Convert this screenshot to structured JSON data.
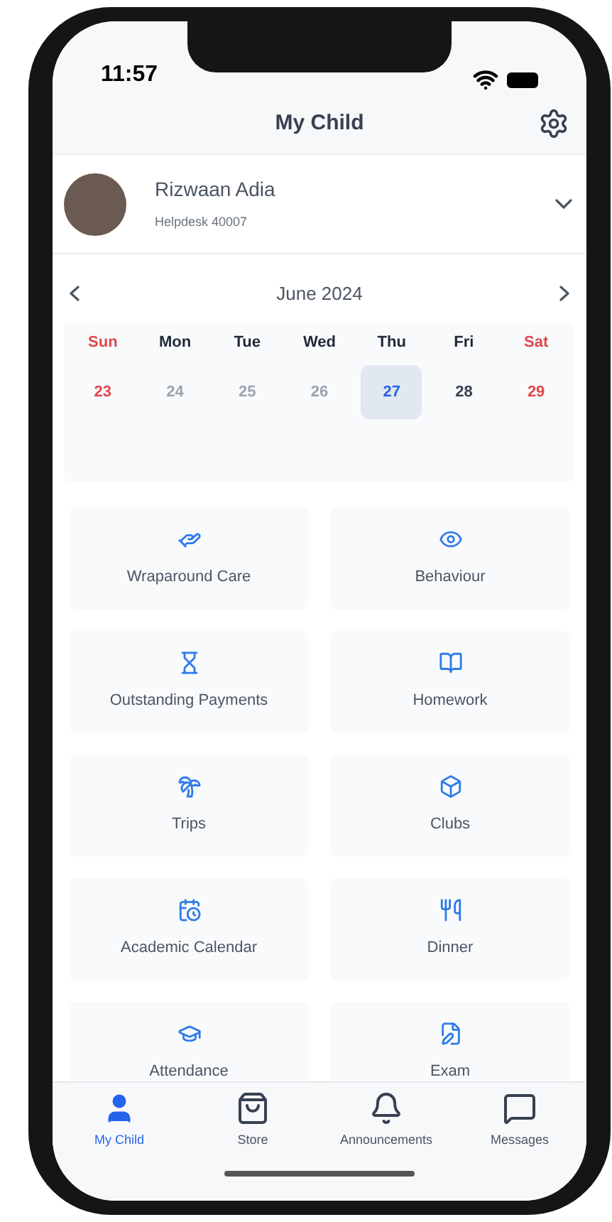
{
  "status_bar": {
    "time": "11:57"
  },
  "header": {
    "title": "My Child"
  },
  "profile": {
    "name": "Rizwaan Adia",
    "subtitle": "Helpdesk 40007"
  },
  "calendar": {
    "month": "June 2024",
    "weekdays": [
      {
        "label": "Sun",
        "weekend": true
      },
      {
        "label": "Mon",
        "weekend": false
      },
      {
        "label": "Tue",
        "weekend": false
      },
      {
        "label": "Wed",
        "weekend": false
      },
      {
        "label": "Thu",
        "weekend": false
      },
      {
        "label": "Fri",
        "weekend": false
      },
      {
        "label": "Sat",
        "weekend": true
      }
    ],
    "dates": [
      {
        "label": "23",
        "kind": "weekend",
        "selected": false
      },
      {
        "label": "24",
        "kind": "past",
        "selected": false
      },
      {
        "label": "25",
        "kind": "past",
        "selected": false
      },
      {
        "label": "26",
        "kind": "past",
        "selected": false
      },
      {
        "label": "27",
        "kind": "normal",
        "selected": true
      },
      {
        "label": "28",
        "kind": "normal",
        "selected": false
      },
      {
        "label": "29",
        "kind": "weekend",
        "selected": false
      }
    ]
  },
  "tiles": [
    {
      "label": "Wraparound Care"
    },
    {
      "label": "Behaviour"
    },
    {
      "label": "Outstanding Payments"
    },
    {
      "label": "Homework"
    },
    {
      "label": "Trips"
    },
    {
      "label": "Clubs"
    },
    {
      "label": "Academic Calendar"
    },
    {
      "label": "Dinner"
    },
    {
      "label": "Attendance"
    },
    {
      "label": "Exam"
    }
  ],
  "tab_bar": [
    {
      "label": "My Child",
      "selected": true
    },
    {
      "label": "Store",
      "selected": false
    },
    {
      "label": "Announcements",
      "selected": false
    },
    {
      "label": "Messages",
      "selected": false
    }
  ]
}
